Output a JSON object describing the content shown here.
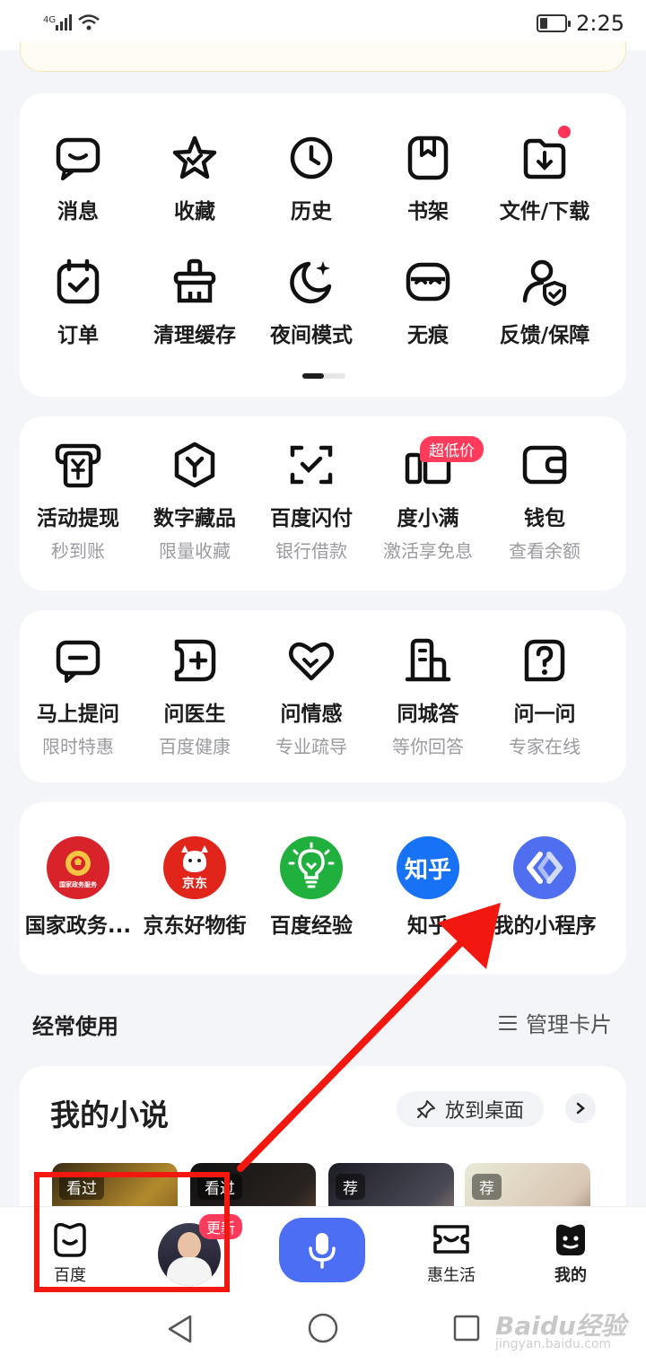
{
  "status_bar": {
    "network": "4G",
    "time": "2:25"
  },
  "quick_tools": [
    {
      "label": "消息",
      "icon": "message-icon"
    },
    {
      "label": "收藏",
      "icon": "star-icon"
    },
    {
      "label": "历史",
      "icon": "clock-icon"
    },
    {
      "label": "书架",
      "icon": "bookshelf-icon"
    },
    {
      "label": "文件/下载",
      "icon": "download-folder-icon"
    },
    {
      "label": "订单",
      "icon": "calendar-check-icon"
    },
    {
      "label": "清理缓存",
      "icon": "broom-icon"
    },
    {
      "label": "夜间模式",
      "icon": "moon-icon"
    },
    {
      "label": "无痕",
      "icon": "mask-icon"
    },
    {
      "label": "反馈/保障",
      "icon": "user-shield-icon"
    }
  ],
  "finance": [
    {
      "label": "活动提现",
      "sub": "秒到账",
      "icon": "yen-cash-icon"
    },
    {
      "label": "数字藏品",
      "sub": "限量收藏",
      "icon": "hexagon-y-icon"
    },
    {
      "label": "百度闪付",
      "sub": "银行借款",
      "icon": "scan-pay-icon"
    },
    {
      "label": "度小满",
      "sub": "激活享免息",
      "icon": "card-icon",
      "badge": "超低价"
    },
    {
      "label": "钱包",
      "sub": "查看余额",
      "icon": "wallet-icon"
    }
  ],
  "qa": [
    {
      "label": "马上提问",
      "sub": "限时特惠",
      "icon": "ask-bubble-icon"
    },
    {
      "label": "问医生",
      "sub": "百度健康",
      "icon": "medical-icon"
    },
    {
      "label": "问情感",
      "sub": "专业疏导",
      "icon": "heart-icon"
    },
    {
      "label": "同城答",
      "sub": "等你回答",
      "icon": "building-icon"
    },
    {
      "label": "问一问",
      "sub": "专家在线",
      "icon": "question-icon"
    }
  ],
  "mini_apps": [
    {
      "label": "国家政务...",
      "icon": "gov-emblem-icon",
      "icon_text": "国家政务服务",
      "color": "#d8232a"
    },
    {
      "label": "京东好物街",
      "icon": "jd-dog-icon",
      "icon_text": "京东",
      "color": "#e1251b"
    },
    {
      "label": "百度经验",
      "icon": "lightbulb-icon",
      "icon_text": "",
      "color": "#20b03d"
    },
    {
      "label": "知乎",
      "icon": "zhihu-icon",
      "icon_text": "知乎",
      "color": "#1772f6"
    },
    {
      "label": "我的小程序",
      "icon": "mini-program-icon",
      "icon_text": "",
      "color": "#4f6ff0"
    }
  ],
  "frequent": {
    "title": "经常使用",
    "manage": "管理卡片"
  },
  "novels": {
    "title": "我的小说",
    "pin_label": "放到桌面",
    "books": [
      {
        "tag": "看过"
      },
      {
        "tag": "看过"
      },
      {
        "tag": "荐"
      },
      {
        "tag": "荐"
      }
    ]
  },
  "tabbar": {
    "home": "百度",
    "update_badge": "更新",
    "life": "惠生活",
    "mine": "我的"
  },
  "watermark": {
    "main": "Baidu经验",
    "sub": "jingyan.baidu.com"
  },
  "colors": {
    "accent": "#4c6ef5",
    "highlight": "#f2180f",
    "badge": "#ff3b5c"
  }
}
